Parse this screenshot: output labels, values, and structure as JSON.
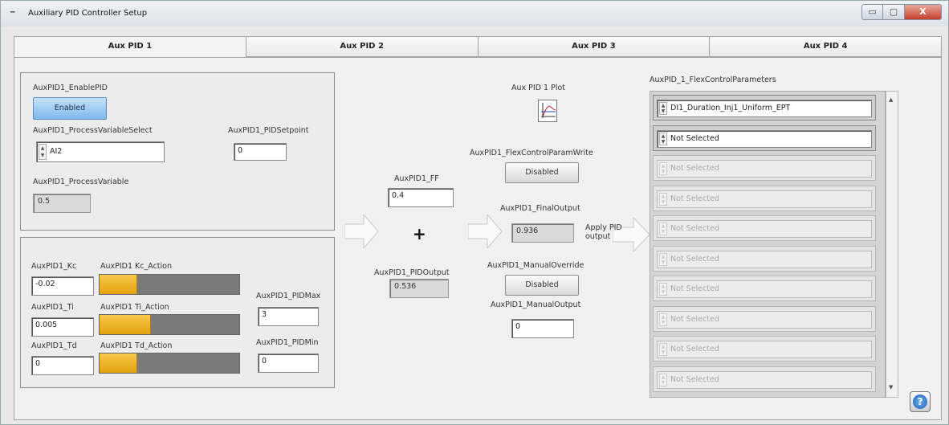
{
  "window": {
    "title": "Auxiliary PID Controller Setup",
    "minimize": "▭",
    "maximize": "▢",
    "close": "X"
  },
  "tabs": [
    "Aux PID 1",
    "Aux PID 2",
    "Aux PID 3",
    "Aux PID 4"
  ],
  "enable": {
    "label": "AuxPID1_EnablePID",
    "button": "Enabled"
  },
  "pv_select": {
    "label": "AuxPID1_ProcessVariableSelect",
    "value": "AI2"
  },
  "setpoint": {
    "label": "AuxPID1_PIDSetpoint",
    "value": "0"
  },
  "pv": {
    "label": "AuxPID1_ProcessVariable",
    "value": "0.5"
  },
  "kc": {
    "label": "AuxPID1_Kc",
    "value": "-0.02",
    "action_label": "AuxPID1 Kc_Action",
    "action_level": 0.27
  },
  "ti": {
    "label": "AuxPID1_Ti",
    "value": "0.005",
    "action_label": "AuxPID1 Ti_Action",
    "action_level": 0.37
  },
  "td": {
    "label": "AuxPID1_Td",
    "value": "0",
    "action_label": "AuxPID1 Td_Action",
    "action_level": 0.27
  },
  "pidmax": {
    "label": "AuxPID1_PIDMax",
    "value": "3"
  },
  "pidmin": {
    "label": "AuxPID1_PIDMin",
    "value": "0"
  },
  "ff": {
    "label": "AuxPID1_FF",
    "value": "0.4"
  },
  "plus": "+",
  "pidoutput": {
    "label": "AuxPID1_PIDOutput",
    "value": "0.536"
  },
  "plot": {
    "label": "Aux PID 1 Plot"
  },
  "flexwrite": {
    "label": "AuxPID1_FlexControlParamWrite",
    "button": "Disabled"
  },
  "finaloutput": {
    "label": "AuxPID1_FinalOutput",
    "value": "0.936"
  },
  "apply": "Apply PID output",
  "override": {
    "label": "AuxPID1_ManualOverride",
    "button": "Disabled"
  },
  "manualoutput": {
    "label": "AuxPID1_ManualOutput",
    "value": "0"
  },
  "flex": {
    "label": "AuxPID_1_FlexControlParameters",
    "items": [
      "DI1_Duration_Inj1_Uniform_EPT",
      "Not Selected",
      "Not Selected",
      "Not Selected",
      "Not Selected",
      "Not Selected",
      "Not Selected",
      "Not Selected",
      "Not Selected",
      "Not Selected"
    ]
  },
  "colors": {
    "bar_fill": "#eab01f",
    "bar_bg": "#7a7a7a",
    "enabled_button": "#9ccbf3"
  },
  "icons": {
    "help": "question-icon",
    "plot": "plot-icon"
  },
  "help_glyph": "?"
}
